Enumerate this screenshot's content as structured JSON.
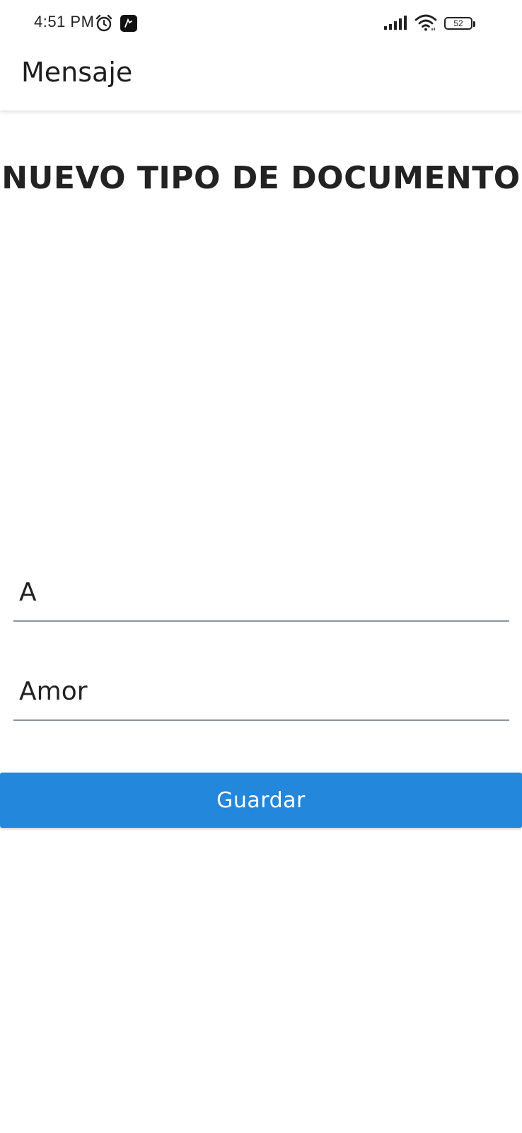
{
  "status_bar": {
    "time": "4:51 PM",
    "battery_level": "52",
    "icons": [
      "alarm-icon",
      "app-notification-icon",
      "signal-icon",
      "wifi-icon",
      "battery-icon"
    ]
  },
  "app_bar": {
    "title": "Mensaje"
  },
  "main": {
    "title": "NUEVO TIPO DE DOCUMENTO",
    "fields": [
      {
        "value": "A"
      },
      {
        "value": "Amor"
      }
    ],
    "save_button": {
      "label": "Guardar",
      "color": "#2387dc"
    }
  }
}
